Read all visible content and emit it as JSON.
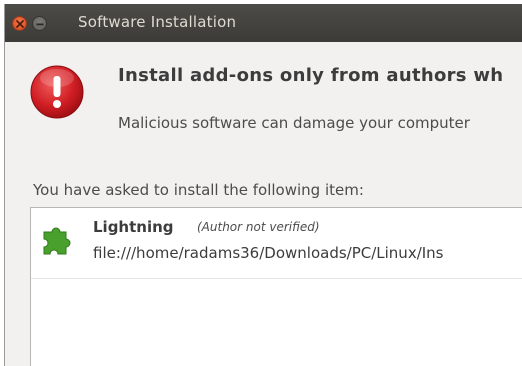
{
  "window": {
    "title": "Software Installation"
  },
  "dialog": {
    "icon": "warning-icon",
    "heading": "Install add-ons only from authors wh",
    "message": "Malicious software can damage your computer",
    "prompt": "You have asked to install the following item:"
  },
  "items": [
    {
      "icon": "puzzle-icon",
      "name": "Lightning",
      "note": "(Author not verified)",
      "path": "file:///home/radams36/Downloads/PC/Linux/Ins"
    }
  ],
  "colors": {
    "titlebar": "#3c3b37",
    "close_button": "#e0582c",
    "warning_red": "#c8171d",
    "puzzle_green": "#4aa02c"
  }
}
